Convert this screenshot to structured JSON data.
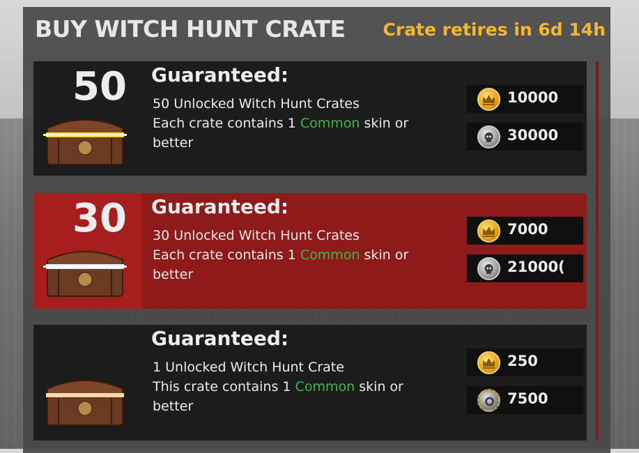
{
  "header": {
    "title": "BUY WITCH HUNT CRATE",
    "retire_text": "Crate retires in 6d 14h"
  },
  "offers": [
    {
      "quantity": "50",
      "heading": "Guaranteed:",
      "line1": "50 Unlocked Witch Hunt Crates",
      "line2_pre": "Each crate contains 1 ",
      "rarity": "Common",
      "line2_post": " skin or",
      "line3": "better",
      "gold_price": "10000",
      "alt_price": "30000",
      "alt_currency_icon": "silver-skull-coin-icon"
    },
    {
      "quantity": "30",
      "heading": "Guaranteed:",
      "line1": "30 Unlocked Witch Hunt Crates",
      "line2_pre": "Each crate contains 1 ",
      "rarity": "Common",
      "line2_post": " skin or",
      "line3": "better",
      "gold_price": "7000",
      "alt_price": "21000(",
      "alt_currency_icon": "silver-skull-coin-icon"
    },
    {
      "quantity": "",
      "heading": "Guaranteed:",
      "line1": "1 Unlocked Witch Hunt Crate",
      "line2_pre": "This crate contains 1 ",
      "rarity": "Common",
      "line2_post": " skin or",
      "line3": "better",
      "gold_price": "250",
      "alt_price": "7500",
      "alt_currency_icon": "gear-coin-icon"
    }
  ],
  "colors": {
    "accent": "#f5b72b",
    "common": "#3fb64a",
    "selected_row": "#8e1a1a"
  }
}
